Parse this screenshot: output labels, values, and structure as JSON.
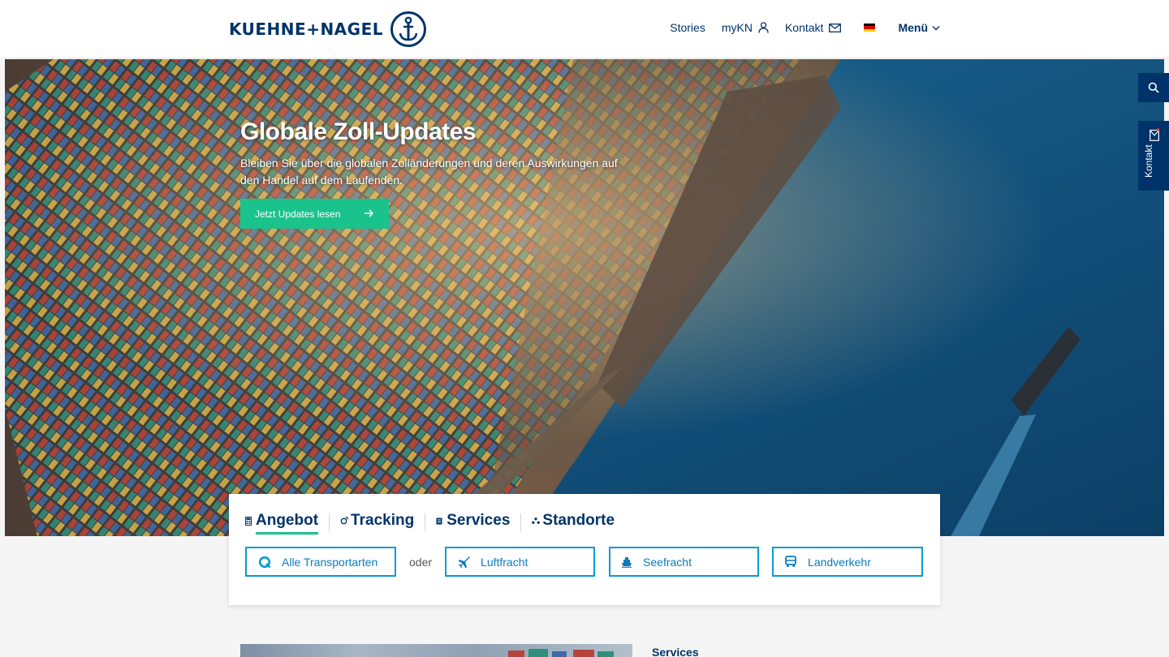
{
  "brand": {
    "name": "KUEHNE+NAGEL",
    "primary_color": "#003369",
    "accent_color": "#1ac38b",
    "link_color": "#0a9bd2"
  },
  "nav": {
    "stories": "Stories",
    "mykn": "myKN",
    "kontakt": "Kontakt",
    "language_icon": "flag-germany-icon",
    "menu": "Menü"
  },
  "hero": {
    "title": "Globale Zoll-Updates",
    "subtitle": "Bleiben Sie über die globalen Zolländerungen und deren Auswirkungen auf den Handel auf dem Laufenden.",
    "cta": "Jetzt Updates lesen"
  },
  "side": {
    "search_icon": "search-icon",
    "contact_label": "Kontakt"
  },
  "panel": {
    "tabs": [
      {
        "label": "Angebot",
        "icon": "calculator-icon",
        "active": true
      },
      {
        "label": "Tracking",
        "icon": "tracking-icon",
        "active": false
      },
      {
        "label": "Services",
        "icon": "services-icon",
        "active": false
      },
      {
        "label": "Standorte",
        "icon": "locations-icon",
        "active": false
      }
    ],
    "all_transport": "Alle Transportarten",
    "or": "oder",
    "air": "Luftfracht",
    "sea": "Seefracht",
    "land": "Landverkehr"
  },
  "teaser": {
    "label": "Services"
  }
}
